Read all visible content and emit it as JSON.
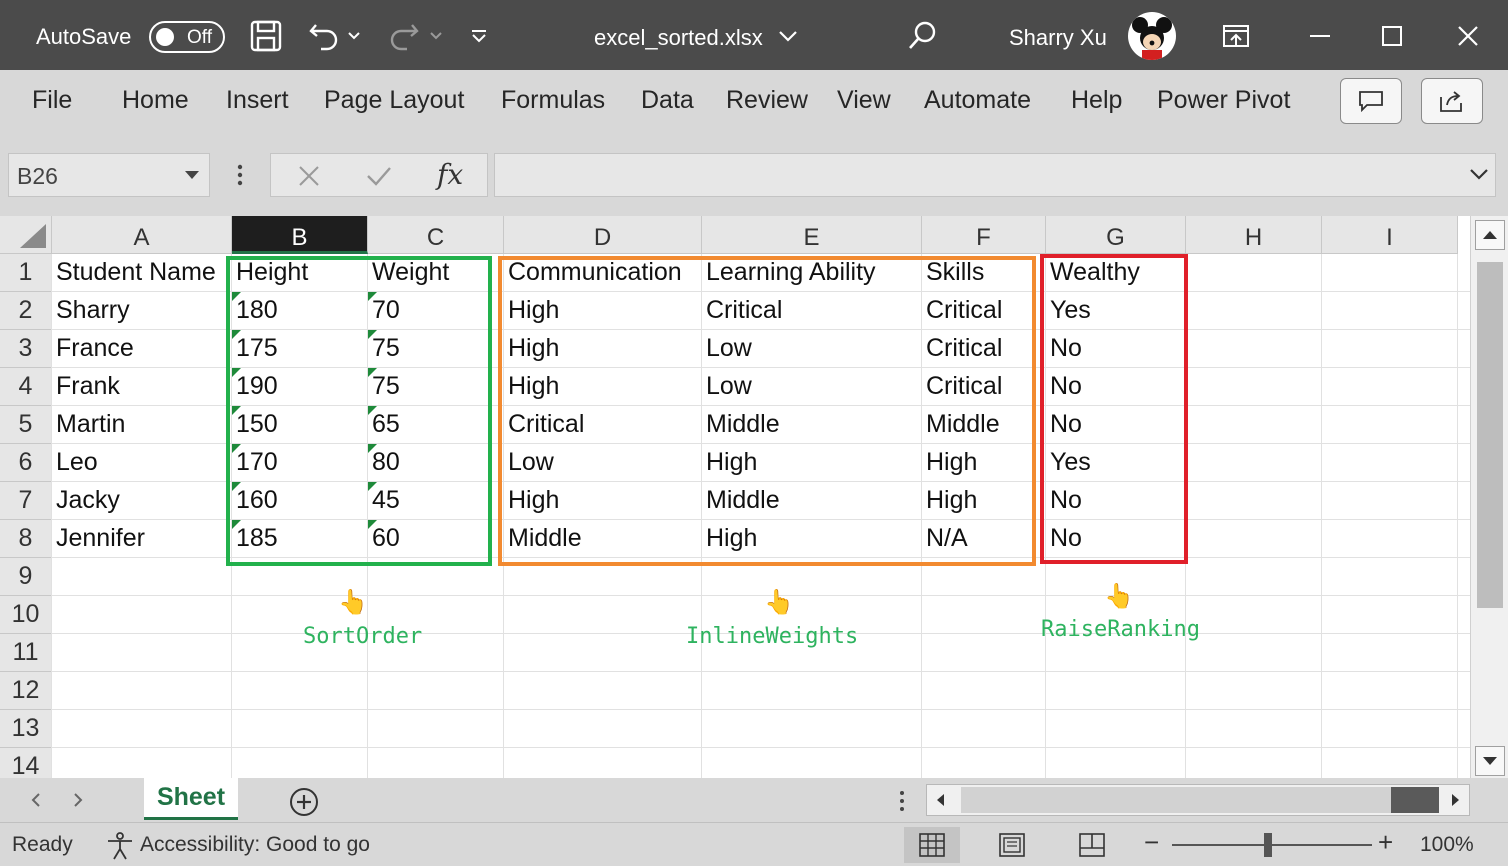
{
  "titlebar": {
    "autosave_label": "AutoSave",
    "autosave_state": "Off",
    "filename": "excel_sorted.xlsx",
    "user": "Sharry Xu"
  },
  "menu": [
    "File",
    "Home",
    "Insert",
    "Page Layout",
    "Formulas",
    "Data",
    "Review",
    "View",
    "Automate",
    "Help",
    "Power Pivot"
  ],
  "formula_bar": {
    "name_box": "B26",
    "fx_label": "fx",
    "formula": ""
  },
  "columns": [
    "A",
    "B",
    "C",
    "D",
    "E",
    "F",
    "G",
    "H",
    "I"
  ],
  "selected_column": "B",
  "rows": [
    "1",
    "2",
    "3",
    "4",
    "5",
    "6",
    "7",
    "8",
    "9",
    "10",
    "11",
    "12",
    "13",
    "14"
  ],
  "table": {
    "headers": [
      "Student Name",
      "Height",
      "Weight",
      "Communication",
      "Learning Ability",
      "Skills",
      "Wealthy"
    ],
    "rows": [
      [
        "Sharry",
        "180",
        "70",
        "High",
        "Critical",
        "Critical",
        "Yes"
      ],
      [
        "France",
        "175",
        "75",
        "High",
        "Low",
        "Critical",
        "No"
      ],
      [
        "Frank",
        "190",
        "75",
        "High",
        "Low",
        "Critical",
        "No"
      ],
      [
        "Martin",
        "150",
        "65",
        "Critical",
        "Middle",
        "Middle",
        "No"
      ],
      [
        "Leo",
        "170",
        "80",
        "Low",
        "High",
        "High",
        "Yes"
      ],
      [
        "Jacky",
        "160",
        "45",
        "High",
        "Middle",
        "High",
        "No"
      ],
      [
        "Jennifer",
        "185",
        "60",
        "Middle",
        "High",
        "N/A",
        "No"
      ]
    ]
  },
  "annotations": {
    "sort_order": "SortOrder",
    "inline_weights": "InlineWeights",
    "raise_ranking": "RaiseRanking"
  },
  "highlight_colors": {
    "green": "#22b14c",
    "orange": "#f28a30",
    "red": "#e0202a"
  },
  "sheet_tab": "Sheet",
  "status": {
    "ready": "Ready",
    "accessibility": "Accessibility: Good to go",
    "zoom": "100%"
  }
}
